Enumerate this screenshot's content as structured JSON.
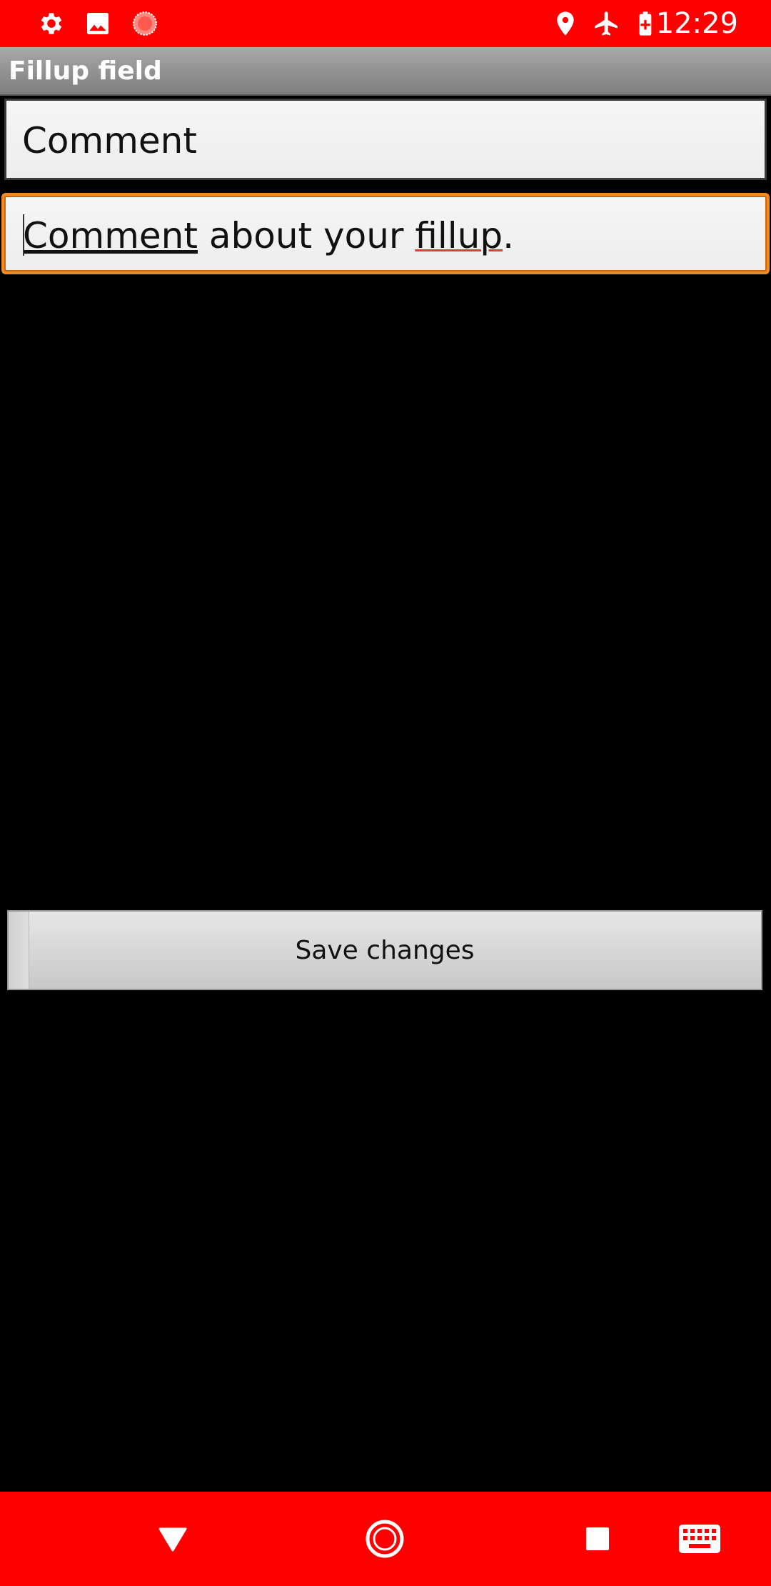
{
  "status_bar": {
    "left_icons": [
      "gear-icon",
      "image-icon",
      "recording-icon"
    ],
    "right_icons": [
      "location-icon",
      "airplane-icon",
      "battery-charging-icon"
    ],
    "time": "12:29",
    "color": "#ff0000"
  },
  "title_bar": {
    "title": "Fillup field"
  },
  "form": {
    "label_field": {
      "value": "Comment"
    },
    "comment_field": {
      "value_parts": [
        "Comment",
        " about your ",
        "fillup",
        "."
      ],
      "focused": true,
      "focus_color": "#f58a1f"
    }
  },
  "save_button": {
    "label": "Save changes"
  },
  "nav_bar": {
    "items": [
      "back-icon",
      "home-icon",
      "recents-icon",
      "keyboard-icon"
    ],
    "color": "#ff0000"
  }
}
